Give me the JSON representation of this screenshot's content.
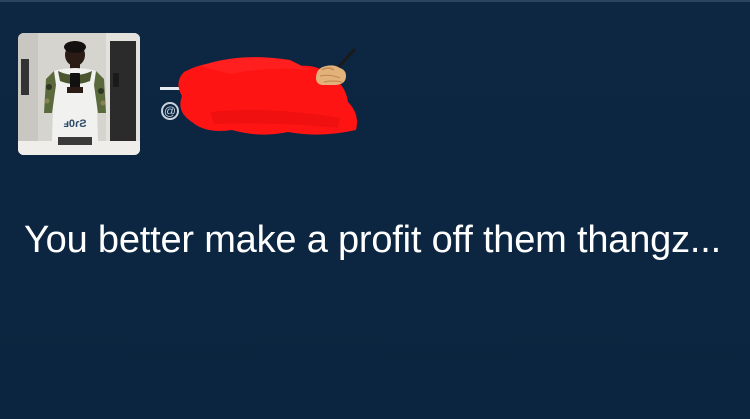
{
  "tweet": {
    "text": "You better make a profit off them thangz..."
  },
  "profile": {
    "handle_prefix": "@",
    "avatar_jersey_text": "ⅎ0ɾƧ"
  },
  "colors": {
    "background": "#0c2540",
    "text": "#ffffff",
    "redaction": "#ff1414"
  },
  "icons": {
    "writing_hand": "writing-hand-emoji"
  }
}
